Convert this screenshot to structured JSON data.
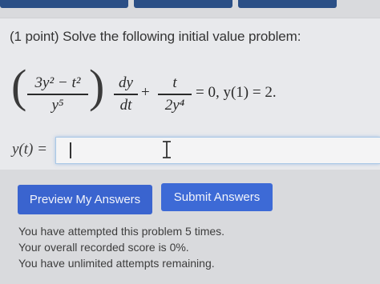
{
  "problem": {
    "intro": "(1 point) Solve the following initial value problem:",
    "equation": {
      "frac1_num": "3y² − t²",
      "frac1_den": "y⁵",
      "deriv_num": "dy",
      "deriv_den": "dt",
      "plus": "+",
      "frac2_num": "t",
      "frac2_den": "2y⁴",
      "rest": "= 0,  y(1) = 2."
    }
  },
  "answer": {
    "label": "y(t) =",
    "value": ""
  },
  "buttons": {
    "preview": "Preview My Answers",
    "submit": "Submit Answers"
  },
  "status": {
    "line1": "You have attempted this problem 5 times.",
    "line2": "Your overall recorded score is 0%.",
    "line3": "You have unlimited attempts remaining."
  },
  "colors": {
    "button": "#3b68d4",
    "tabs": "#2b4f86",
    "input_focus": "#a9c8e6"
  }
}
